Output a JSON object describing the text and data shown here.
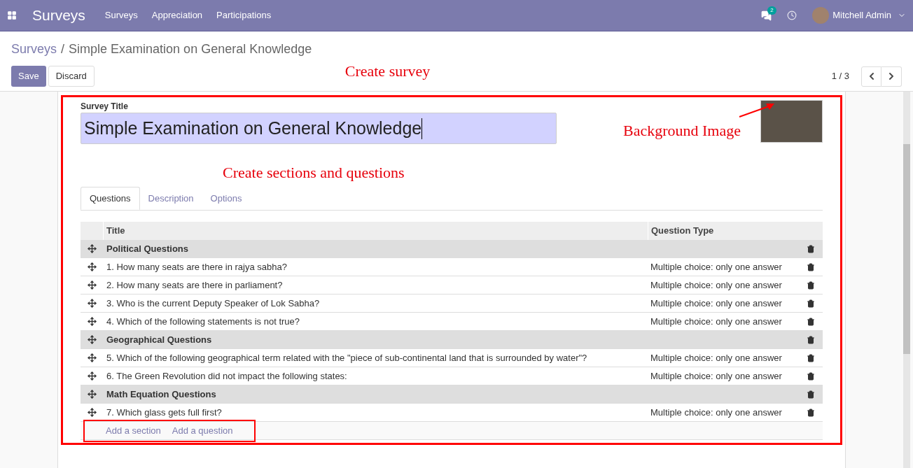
{
  "navbar": {
    "app_name": "Surveys",
    "menu": [
      "Surveys",
      "Appreciation",
      "Participations"
    ],
    "chat_badge": "2",
    "user": "Mitchell Admin"
  },
  "breadcrumb": {
    "parent": "Surveys",
    "separator": "/",
    "current": "Simple Examination on General Knowledge"
  },
  "buttons": {
    "save": "Save",
    "discard": "Discard"
  },
  "pager": "1 / 3",
  "annotations": {
    "create_survey": "Create survey",
    "background_image": "Background Image",
    "sections_questions": "Create sections and questions"
  },
  "form": {
    "title_label": "Survey Title",
    "title_value": "Simple Examination on General Knowledge"
  },
  "tabs": [
    {
      "label": "Questions",
      "selected": true
    },
    {
      "label": "Description",
      "selected": false
    },
    {
      "label": "Options",
      "selected": false
    }
  ],
  "table": {
    "columns": [
      "Title",
      "Question Type"
    ],
    "rows": [
      {
        "kind": "section",
        "title": "Political Questions"
      },
      {
        "kind": "question",
        "title": "1. How many seats are there in rajya sabha?",
        "type": "Multiple choice: only one answer"
      },
      {
        "kind": "question",
        "title": "2. How many seats are there in parliament?",
        "type": "Multiple choice: only one answer"
      },
      {
        "kind": "question",
        "title": "3. Who is the current Deputy Speaker of Lok Sabha?",
        "type": "Multiple choice: only one answer"
      },
      {
        "kind": "question",
        "title": "4. Which of the following statements is not true?",
        "type": "Multiple choice: only one answer"
      },
      {
        "kind": "section",
        "title": "Geographical Questions"
      },
      {
        "kind": "question",
        "title": "5. Which of the following geographical term related with the \"piece of sub-continental land that is surrounded by water\"?",
        "type": "Multiple choice: only one answer"
      },
      {
        "kind": "question",
        "title": "6. The Green Revolution did not impact the following states:",
        "type": "Multiple choice: only one answer"
      },
      {
        "kind": "section",
        "title": "Math Equation Questions"
      },
      {
        "kind": "question",
        "title": "7. Which glass gets full first?",
        "type": "Multiple choice: only one answer"
      }
    ],
    "add_links": [
      "Add a section",
      "Add a question"
    ]
  }
}
